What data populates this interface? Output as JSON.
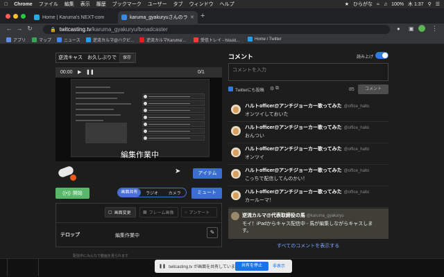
{
  "menubar": {
    "items": [
      "Chrome",
      "ファイル",
      "編集",
      "表示",
      "履歴",
      "ブックマーク",
      "ユーザー",
      "タブ",
      "ウィンドウ",
      "ヘルプ"
    ],
    "ime": "ひらがな",
    "battery": "100%",
    "clock": "木 1:37"
  },
  "tabs": [
    {
      "title": "Home | Karuma's NEXT-com",
      "favicon_color": "#2aa9e0"
    },
    {
      "title": "karuma_gyakuryuさんのラ",
      "favicon_color": "#3b8ae0"
    }
  ],
  "address": {
    "host": "twitcasting.tv",
    "path": "/karuma_gyakuryu/broadcaster"
  },
  "bookmarks": [
    {
      "label": "アプリ",
      "icon_color": "#5f8ee8"
    },
    {
      "label": "マップ",
      "icon_color": "#34a853"
    },
    {
      "label": "ニュース",
      "icon_color": "#4285f4"
    },
    {
      "label": "逆流カルマ@ハクビ...",
      "icon_color": "#1da1f2"
    },
    {
      "label": "逆流カルマKaruma'...",
      "icon_color": "#e62117"
    },
    {
      "label": "受信トレイ - hisuid...",
      "icon_color": "#ea4335"
    },
    {
      "label": "Home / Twitter",
      "icon_color": "#1da1f2"
    }
  ],
  "broadcast": {
    "title_value": "逆流キャス　お久しぶりで",
    "save_label": "保存",
    "timer": "00:00",
    "page_counter": "0/1",
    "overlay_text": "編集作業中",
    "item_label": "アイテム",
    "start_label": "開始",
    "sources": [
      "画面共有",
      "ラジオ",
      "カメラ"
    ],
    "mute_label": "ミュート",
    "tools": [
      "画面変更",
      "フレーム画像",
      "アンケート"
    ],
    "telop_label": "テロップ",
    "telop_value": "編集作業中",
    "rec_note": "配信中にみんなで動画を見られます"
  },
  "comments_panel": {
    "heading": "コメント",
    "read_aloud": "読み上げ",
    "placeholder": "コメントを入力",
    "twitter_label": "Twitterにも投稿",
    "counter": "85",
    "submit": "コメント",
    "comments": [
      {
        "name": "ハルトofficer@アンチジョーカー歌ってみた",
        "handle": "@office_halto",
        "text": "オンツイしておいた"
      },
      {
        "name": "ハルトofficer@アンチジョーカー歌ってみた",
        "handle": "@office_halto",
        "text": "おんつい"
      },
      {
        "name": "ハルトofficer@アンチジョーカー歌ってみた",
        "handle": "@office_halto",
        "text": "オンツイ"
      },
      {
        "name": "ハルトofficer@アンチジョーカー歌ってみた",
        "handle": "@office_halto",
        "text": "こっちで配信してんのかい！"
      },
      {
        "name": "ハルトofficer@アンチジョーカー歌ってみた",
        "handle": "@office_halto",
        "text": "カールーマ！"
      }
    ],
    "highlight": {
      "name": "逆流カルマ@代表取締役の馬",
      "handle": "@karuma_gyakuryu",
      "text": "モイ！iPadからキャス配信中 - 馬が編集しながらキャスします。"
    },
    "view_all": "すべてのコメントを表示する"
  },
  "sharebar": {
    "message": "twitcasting.tv が画面を共有しています。",
    "stop_label": "共有を停止",
    "hide_label": "非表示"
  }
}
